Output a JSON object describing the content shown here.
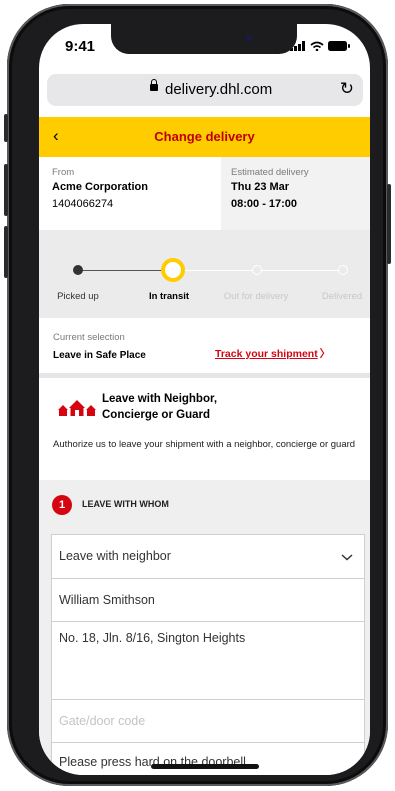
{
  "status_bar": {
    "time": "9:41"
  },
  "browser": {
    "url": "delivery.dhl.com"
  },
  "header": {
    "back_symbol": "‹",
    "title": "Change delivery"
  },
  "shipment": {
    "from_label": "From",
    "from_name": "Acme Corporation",
    "tracking_number": "1404066274",
    "estimated_label": "Estimated delivery",
    "estimated_date": "Thu 23 Mar",
    "estimated_time": "08:00 - 17:00"
  },
  "progress": {
    "steps": [
      "Picked up",
      "In transit",
      "Out for delivery",
      "Delivered"
    ],
    "current_step": 2
  },
  "selection": {
    "current_label": "Current selection",
    "current_value": "Leave in Safe Place",
    "track_link": "Track your shipment",
    "track_chevron": "〉"
  },
  "option": {
    "title_line1": "Leave with Neighbor,",
    "title_line2": "Concierge or Guard",
    "description": "Authorize us to leave your shipment with a neighbor, concierge or guard"
  },
  "step1": {
    "number": "1",
    "title": "LEAVE WITH WHOM",
    "dropdown_value": "Leave with neighbor",
    "name_value": "William Smithson",
    "address_value": "No. 18, Jln. 8/16, Sington Heights",
    "gate_placeholder": "Gate/door code",
    "instructions_value": "Please press hard on the doorbell"
  },
  "colors": {
    "brand_yellow": "#ffcc00",
    "brand_red": "#d40511",
    "header_text": "#c00000"
  }
}
